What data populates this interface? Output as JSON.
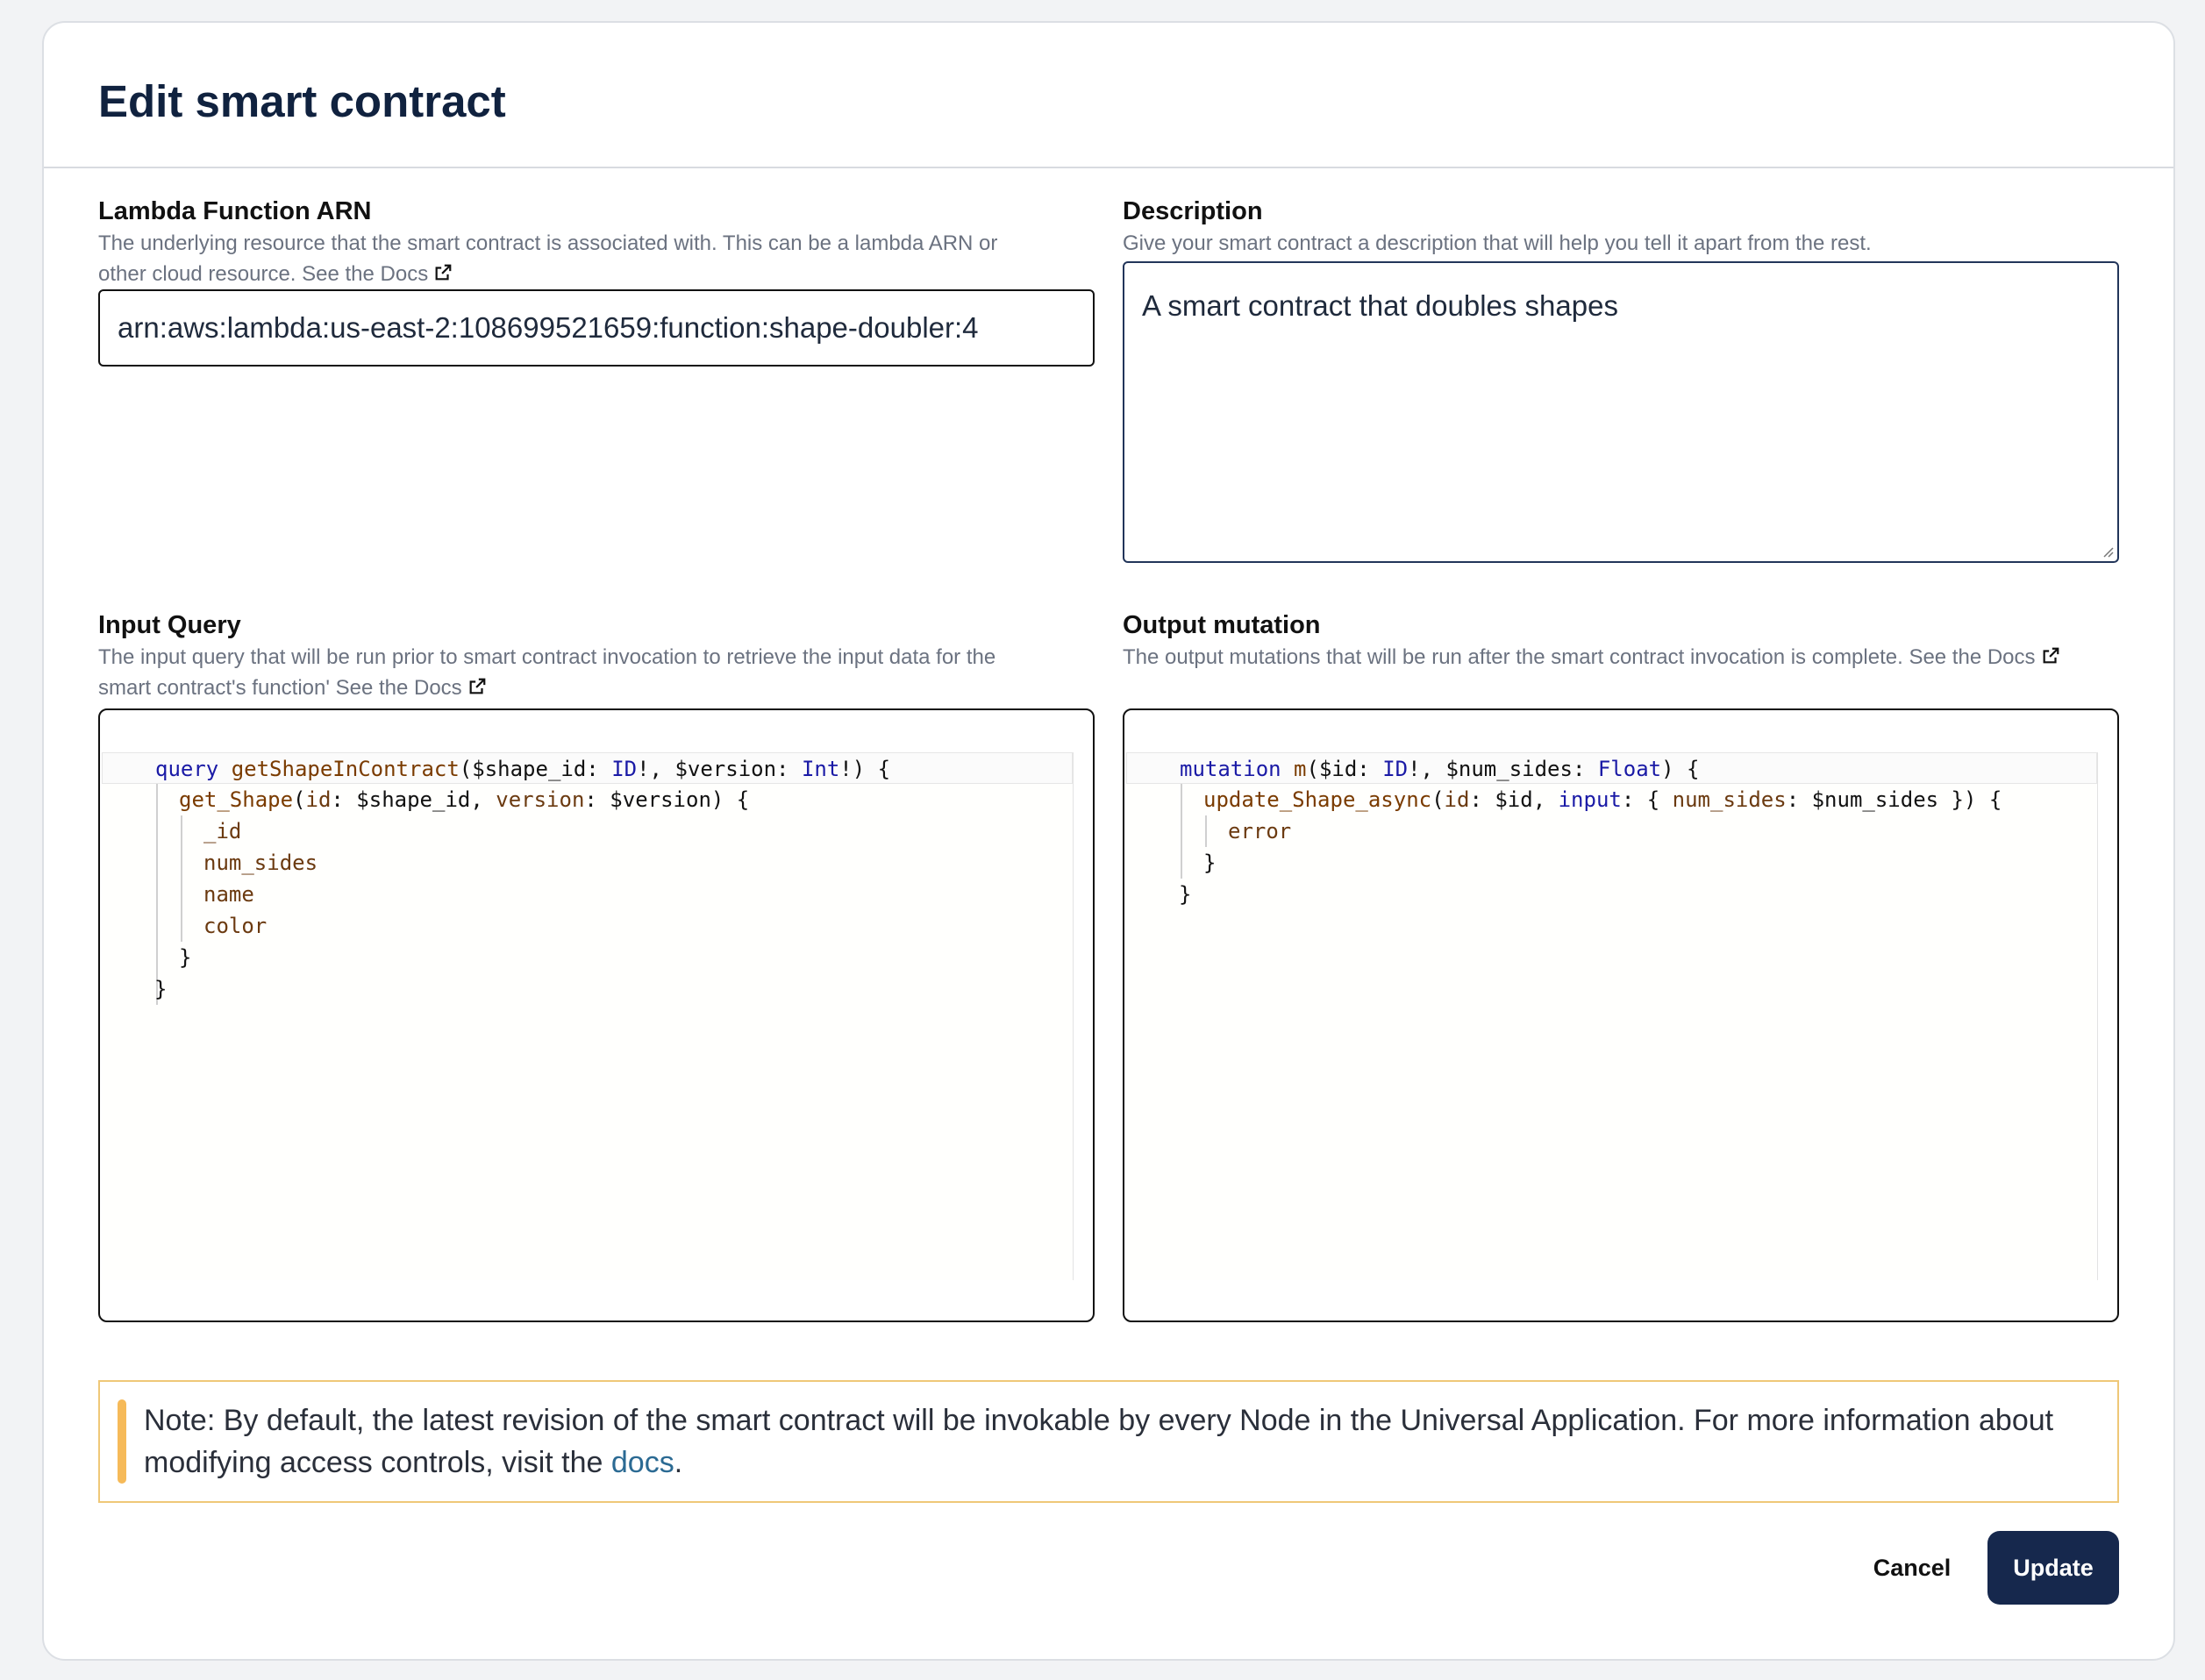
{
  "modal": {
    "title": "Edit smart contract"
  },
  "lambda": {
    "label": "Lambda Function ARN",
    "help_line1": "The underlying resource that the smart contract is associated with. This can be a lambda ARN or",
    "help_line2": "other cloud resource. See the Docs",
    "value": "arn:aws:lambda:us-east-2:108699521659:function:shape-doubler:4"
  },
  "description": {
    "label": "Description",
    "help": "Give your smart contract a description that will help you tell it apart from the rest.",
    "value": "A smart contract that doubles shapes"
  },
  "input_query": {
    "label": "Input Query",
    "help_line1": "The input query that will be run prior to smart contract invocation to retrieve the input data for the",
    "help_line2": "smart contract's function' See the Docs",
    "code": {
      "l1_kw": "query",
      "l1_name": "getShapeInContract",
      "l1_a": "($shape_id: ",
      "l1_t1": "ID",
      "l1_b": "!, $version: ",
      "l1_t2": "Int",
      "l1_c": "!) {",
      "l2_name": "get_Shape",
      "l2_a": "(",
      "l2_arg1": "id",
      "l2_b": ": $shape_id, ",
      "l2_arg2": "version",
      "l2_c": ": $version) {",
      "l3": "_id",
      "l4": "num_sides",
      "l5": "name",
      "l6": "color",
      "l7": "}",
      "l8": "}"
    }
  },
  "output_mutation": {
    "label": "Output mutation",
    "help": "The output mutations that will be run after the smart contract invocation is complete. See the Docs",
    "code": {
      "l1_kw": "mutation",
      "l1_name": "m",
      "l1_a": "($id: ",
      "l1_t1": "ID",
      "l1_b": "!, $num_sides: ",
      "l1_t2": "Float",
      "l1_c": ") {",
      "l2_name": "update_Shape_async",
      "l2_a": "(",
      "l2_arg1": "id",
      "l2_b": ": $id, ",
      "l2_kw": "input",
      "l2_c": ": { ",
      "l2_arg2": "num_sides",
      "l2_d": ": $num_sides }) {",
      "l3": "error",
      "l4": "}",
      "l5": "}"
    }
  },
  "note": {
    "text": "Note: By default, the latest revision of the smart contract will be invokable by every Node in the Universal Application. For more information about modifying access controls, visit the ",
    "link": "docs",
    "end": "."
  },
  "actions": {
    "cancel": "Cancel",
    "update": "Update"
  },
  "colors": {
    "primary": "#16284d",
    "note_accent": "#f6ba59",
    "link": "#2b6a93"
  }
}
